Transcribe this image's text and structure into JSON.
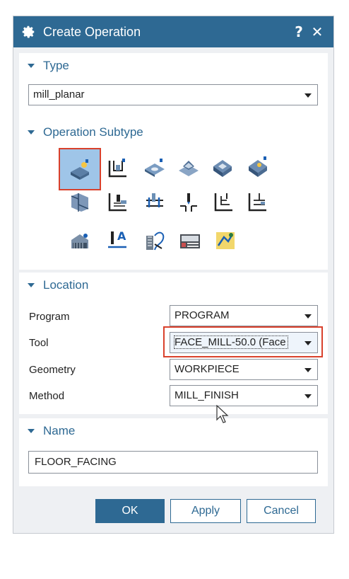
{
  "dialog": {
    "title": "Create Operation",
    "help_glyph": "?",
    "close_glyph": "✕"
  },
  "type_section": {
    "header": "Type",
    "selected": "mill_planar"
  },
  "subtype_section": {
    "header": "Operation Subtype",
    "icon_text_A": "A"
  },
  "location_section": {
    "header": "Location",
    "rows": [
      {
        "label": "Program",
        "value": "PROGRAM"
      },
      {
        "label": "Tool",
        "value": "FACE_MILL-50.0 (Face"
      },
      {
        "label": "Geometry",
        "value": "WORKPIECE"
      },
      {
        "label": "Method",
        "value": "MILL_FINISH"
      }
    ]
  },
  "name_section": {
    "header": "Name",
    "value": "FLOOR_FACING"
  },
  "buttons": {
    "ok": "OK",
    "apply": "Apply",
    "cancel": "Cancel"
  },
  "colors": {
    "accent": "#2e6993",
    "highlight": "#d9412c",
    "selected_bg": "#9fc5e8"
  }
}
